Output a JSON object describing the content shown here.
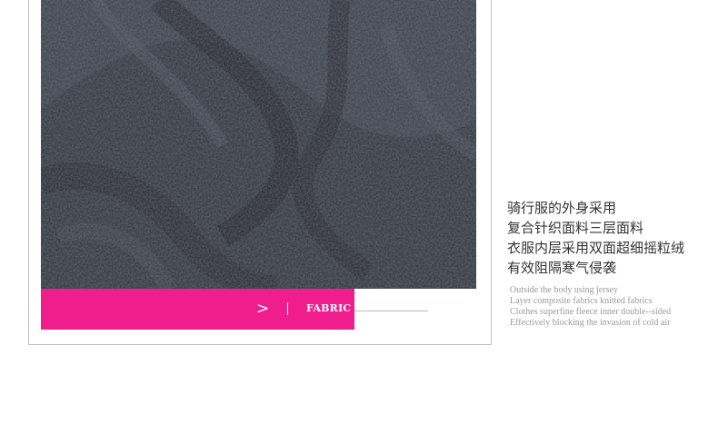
{
  "product_image": {
    "description_icon": "fleece-fabric-photo"
  },
  "banner": {
    "arrow": ">",
    "label": "FABRIC",
    "accent_color": "#f01d8c"
  },
  "description_cn": [
    "骑行服的外身采用",
    "复合针织面料三层面料",
    "衣服内层采用双面超细摇粒绒",
    "有效阻隔寒气侵袭"
  ],
  "description_en": [
    "Outside the body using jersey",
    "Layer composite fabrics knitted fabrics",
    "Clothes superfine fleece inner double--sided",
    "Effectively blocking the invasion of cold air"
  ]
}
